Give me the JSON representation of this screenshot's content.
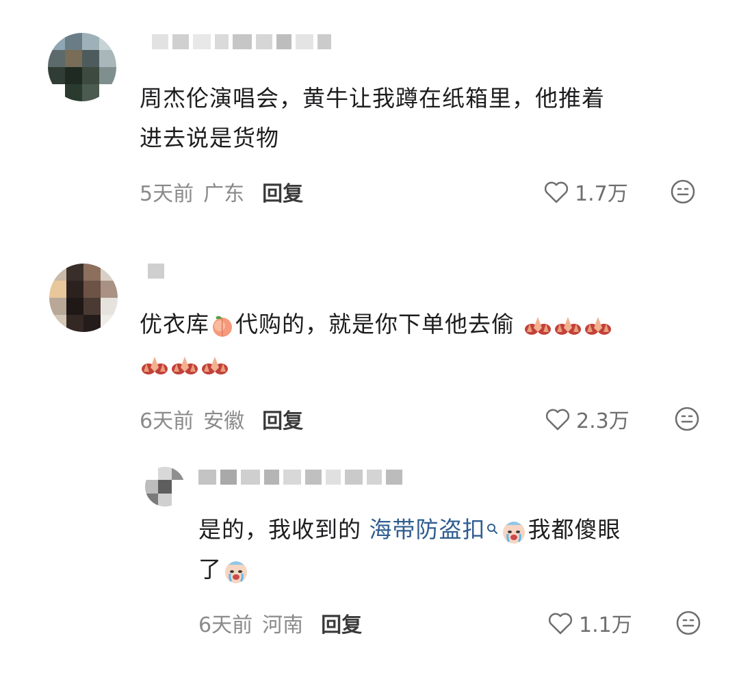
{
  "comments": [
    {
      "text_line1": "周杰伦演唱会，黄牛让我蹲在纸箱里，他推着",
      "text_line2": "进去说是货物",
      "time": "5天前",
      "location": "广东",
      "reply": "回复",
      "likes": "1.7万"
    },
    {
      "text_a": "优衣库",
      "text_b": "代购的，就是你下单他去偷",
      "time": "6天前",
      "location": "安徽",
      "reply": "回复",
      "likes": "2.3万"
    },
    {
      "text_a": "是的，我收到的 ",
      "link": "海带防盗扣",
      "text_b": "我都傻眼",
      "text_line2": "了",
      "time": "6天前",
      "location": "河南",
      "reply": "回复",
      "likes": "1.1万"
    }
  ],
  "icons": {
    "like": "heart-outline-icon",
    "emoji": "smiley-face-icon",
    "peach": "peach-emoji",
    "praying": "praying-hands-emoji",
    "crying": "crying-face-emoji"
  },
  "colors": {
    "text": "#1d1d1f",
    "meta": "#8a8a8a",
    "link": "#2f5d8f"
  }
}
